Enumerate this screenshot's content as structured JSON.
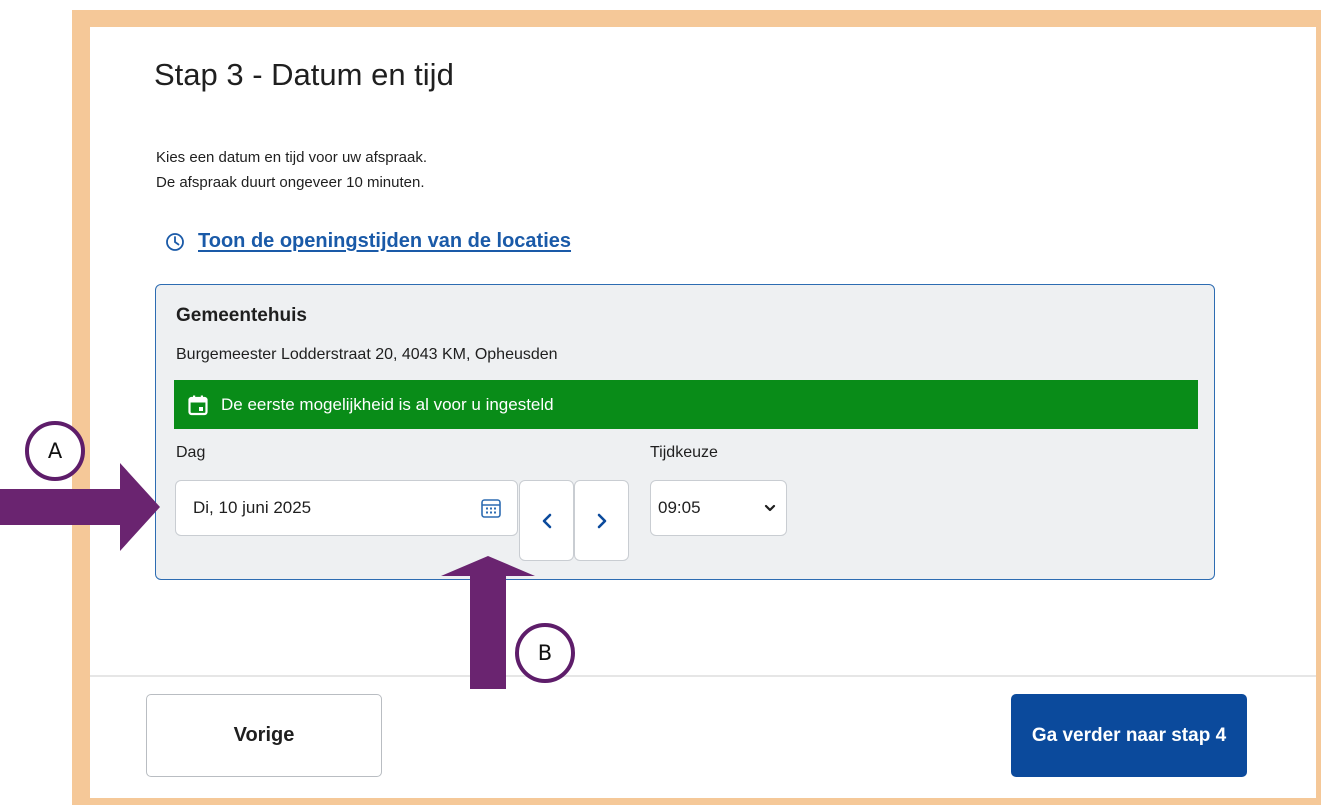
{
  "page": {
    "title": "Stap 3 - Datum en tijd",
    "intro_line1": "Kies een datum en tijd voor uw afspraak.",
    "intro_line2": "De afspraak duurt ongeveer 10 minuten.",
    "hours_link": "Toon de openingstijden van de locaties"
  },
  "location": {
    "name": "Gemeentehuis",
    "address": "Burgemeester Lodderstraat 20, 4043 KM, Opheusden",
    "banner": "De eerste mogelijkheid is al voor u ingesteld",
    "day_label": "Dag",
    "day_value": "Di, 10 juni 2025",
    "time_label": "Tijdkeuze",
    "time_value": "09:05"
  },
  "footer": {
    "prev_label": "Vorige",
    "next_label": "Ga verder naar stap 4"
  },
  "annotations": {
    "a": "A",
    "b": "B"
  },
  "colors": {
    "frame": "#f5c898",
    "link": "#1a5aa8",
    "location_border": "#2d6cb2",
    "banner": "#098c18",
    "primary_button": "#0b4a9c",
    "annotation": "#5e1d6a"
  },
  "icons": {
    "hours_link": "clock-icon",
    "banner": "calendar-icon",
    "date_picker": "calendar-grid-icon",
    "prev_day": "chevron-left-icon",
    "next_day": "chevron-right-icon",
    "time_select": "chevron-down-icon"
  }
}
